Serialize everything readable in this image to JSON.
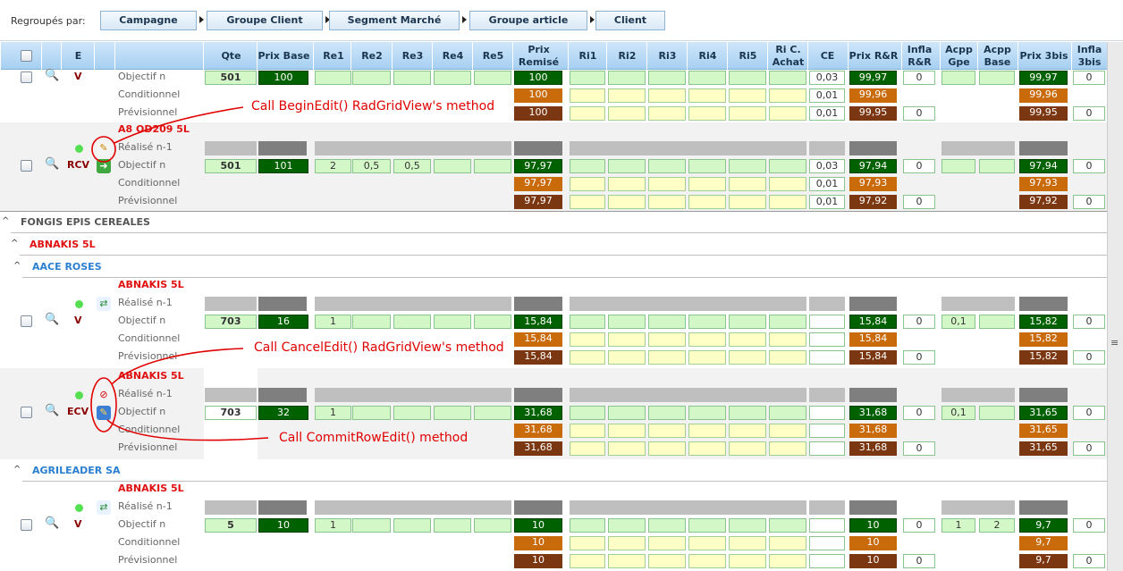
{
  "grouping": {
    "label": "Regroupés par:",
    "chips": [
      "Campagne",
      "Groupe Client",
      "Segment Marché",
      "Groupe article",
      "Client"
    ]
  },
  "columns": [
    "E",
    "Qte",
    "Prix Base",
    "Re1",
    "Re2",
    "Re3",
    "Re4",
    "Re5",
    "Prix Remisé",
    "Ri1",
    "Ri2",
    "Ri3",
    "Ri4",
    "Ri5",
    "Ri C. Achat",
    "CE",
    "Prix R&R",
    "Infla R&R",
    "Acpp Gpe",
    "Acpp Base",
    "Prix 3bis",
    "Infla 3bis"
  ],
  "row_labels": {
    "realise": "Réalisé n-1",
    "objectif": "Objectif n",
    "conditionnel": "Conditionnel",
    "previsionnel": "Prévisionnel"
  },
  "blocks": [
    {
      "status": "V",
      "qte": "501",
      "prix_base": "100",
      "rem": [
        "100",
        "100",
        "100"
      ],
      "ce": [
        "0,03",
        "0,01",
        "0,01"
      ],
      "rr": [
        "99,97",
        "99,96",
        "99,95"
      ],
      "infla": [
        "0",
        "",
        "0"
      ],
      "p3": [
        "99,97",
        "99,96",
        "99,95"
      ],
      "i3": [
        "0",
        "",
        "0"
      ]
    },
    {
      "product": "A8 OD209 5L",
      "status": "RCV",
      "qte": "501",
      "prix_base": "101",
      "re": [
        "2",
        "0,5",
        "0,5"
      ],
      "rem": [
        "97,97",
        "97,97",
        "97,97"
      ],
      "ce": [
        "0,03",
        "0,01",
        "0,01"
      ],
      "rr": [
        "97,94",
        "97,93",
        "97,92"
      ],
      "infla": [
        "0",
        "",
        "0"
      ],
      "p3": [
        "97,94",
        "97,93",
        "97,92"
      ],
      "i3": [
        "0",
        "",
        "0"
      ]
    },
    {
      "product": "ABNAKIS 5L",
      "status": "V",
      "qte": "703",
      "prix_base": "16",
      "re": [
        "1"
      ],
      "rem": [
        "15,84",
        "15,84",
        "15,84"
      ],
      "rr": [
        "15,84",
        "15,84",
        "15,84"
      ],
      "infla": [
        "0",
        "",
        "0"
      ],
      "acpp": [
        "0,1"
      ],
      "p3": [
        "15,82",
        "15,82",
        "15,82"
      ],
      "i3": [
        "0",
        "",
        "0"
      ]
    },
    {
      "product": "ABNAKIS 5L",
      "status": "ECV",
      "qte": "703",
      "prix_base": "32",
      "re": [
        "1"
      ],
      "rem": [
        "31,68",
        "31,68",
        "31,68"
      ],
      "rr": [
        "31,68",
        "31,68",
        "31,68"
      ],
      "infla": [
        "0",
        "",
        "0"
      ],
      "acpp": [
        "0,1"
      ],
      "p3": [
        "31,65",
        "31,65",
        "31,65"
      ],
      "i3": [
        "0",
        "",
        "0"
      ]
    },
    {
      "product": "ABNAKIS 5L",
      "status": "V",
      "qte": "5",
      "prix_base": "10",
      "re": [
        "1"
      ],
      "rem": [
        "10",
        "10",
        "10"
      ],
      "rr": [
        "10",
        "10",
        "10"
      ],
      "infla": [
        "0",
        "",
        "0"
      ],
      "acpp": [
        "1",
        "2"
      ],
      "p3": [
        "9,7",
        "9,7",
        "9,7"
      ],
      "i3": [
        "0",
        "",
        "0"
      ]
    }
  ],
  "groups": [
    "FONGIS EPIS CEREALES",
    "ABNAKIS 5L",
    "AACE ROSES",
    "AGRILEADER SA"
  ],
  "annotations": [
    "Call BeginEdit() RadGridView's method",
    "Call CancelEdit() RadGridView's method",
    "Call CommitRowEdit() method"
  ],
  "colors": {
    "header": "#b9dcf6",
    "green_cell": "#d4f7c7",
    "yellow_cell": "#ffffc6",
    "dark_green": "#006100",
    "orange": "#c96a0b",
    "brown": "#7b3712",
    "annotation": "#e00000"
  }
}
